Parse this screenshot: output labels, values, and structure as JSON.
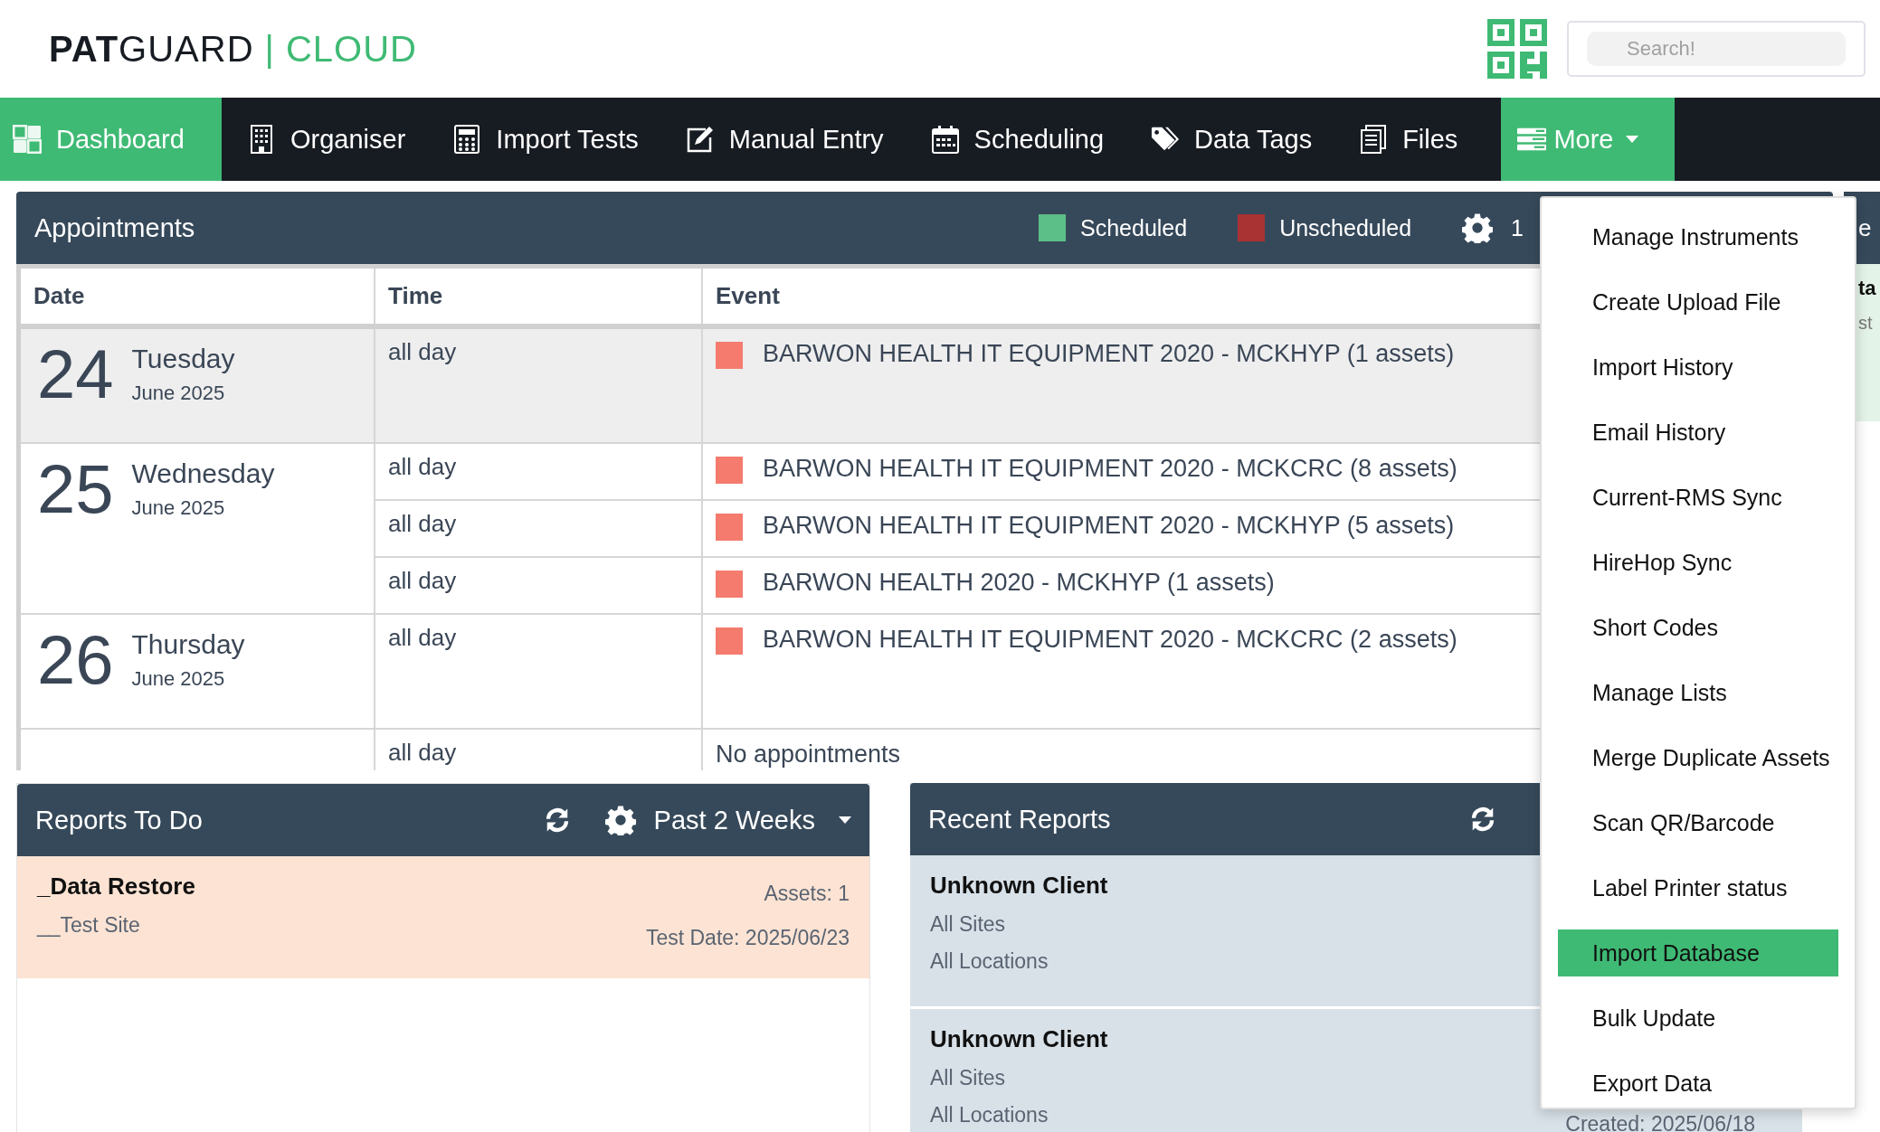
{
  "logo": {
    "bold": "PAT",
    "light": "GUARD",
    "separator": "|",
    "suffix": "CLOUD"
  },
  "search": {
    "placeholder": "Search!"
  },
  "nav": [
    {
      "label": "Dashboard",
      "kind": "dashboard",
      "selected": true
    },
    {
      "label": "Organiser",
      "kind": "building",
      "selected": false
    },
    {
      "label": "Import Tests",
      "kind": "calculator",
      "selected": false
    },
    {
      "label": "Manual Entry",
      "kind": "edit",
      "selected": false
    },
    {
      "label": "Scheduling",
      "kind": "calendar",
      "selected": false
    },
    {
      "label": "Data Tags",
      "kind": "tags",
      "selected": false
    },
    {
      "label": "Files",
      "kind": "files",
      "selected": false
    },
    {
      "label": "More",
      "kind": "list",
      "selected": true,
      "caret": true
    }
  ],
  "appointments": {
    "title": "Appointments",
    "legend": [
      {
        "label": "Scheduled",
        "color": "#5cbf87"
      },
      {
        "label": "Unscheduled",
        "color": "#a93232"
      }
    ],
    "settings_value": "1",
    "columns": [
      "Date",
      "Time",
      "Event"
    ],
    "days": [
      {
        "day": "24",
        "weekday": "Tuesday",
        "month": "June 2025",
        "shaded": true,
        "events": [
          {
            "time": "all day",
            "title": "BARWON HEALTH IT EQUIPMENT 2020 - MCKHYP (1 assets)",
            "color": "#f47b6e"
          }
        ]
      },
      {
        "day": "25",
        "weekday": "Wednesday",
        "month": "June 2025",
        "shaded": false,
        "events": [
          {
            "time": "all day",
            "title": "BARWON HEALTH IT EQUIPMENT 2020 - MCKCRC (8 assets)",
            "color": "#f47b6e"
          },
          {
            "time": "all day",
            "title": "BARWON HEALTH IT EQUIPMENT 2020 - MCKHYP (5 assets)",
            "color": "#f47b6e"
          },
          {
            "time": "all day",
            "title": "BARWON HEALTH 2020 - MCKHYP (1 assets)",
            "color": "#f47b6e"
          }
        ]
      },
      {
        "day": "26",
        "weekday": "Thursday",
        "month": "June 2025",
        "shaded": false,
        "events": [
          {
            "time": "all day",
            "title": "BARWON HEALTH IT EQUIPMENT 2020 - MCKCRC (2 assets)",
            "color": "#f47b6e"
          }
        ]
      },
      {
        "shaded": false,
        "events": [
          {
            "time": "all day",
            "title": "No appointments"
          }
        ]
      }
    ]
  },
  "side_panel": {
    "header": "e",
    "title": "ta",
    "subtitle": "st"
  },
  "reports_to_do": {
    "title": "Reports To Do",
    "filter": "Past 2 Weeks",
    "items": [
      {
        "client": "_Data Restore",
        "site": "__Test Site",
        "assets": "Assets: 1",
        "test_date": "Test Date: 2025/06/23"
      }
    ]
  },
  "recent_reports": {
    "title": "Recent Reports",
    "items": [
      {
        "client": "Unknown Client",
        "site": "All Sites",
        "location": "All Locations"
      },
      {
        "client": "Unknown Client",
        "site": "All Sites",
        "location": "All Locations",
        "created": "Created: 2025/06/18"
      }
    ]
  },
  "more_menu": {
    "items": [
      {
        "label": "Manage Instruments",
        "selected": false
      },
      {
        "label": "Create Upload File",
        "selected": false
      },
      {
        "label": "Import History",
        "selected": false
      },
      {
        "label": "Email History",
        "selected": false
      },
      {
        "label": "Current-RMS Sync",
        "selected": false
      },
      {
        "label": "HireHop Sync",
        "selected": false
      },
      {
        "label": "Short Codes",
        "selected": false
      },
      {
        "label": "Manage Lists",
        "selected": false
      },
      {
        "label": "Merge Duplicate Assets",
        "selected": false
      },
      {
        "label": "Scan QR/Barcode",
        "selected": false
      },
      {
        "label": "Label Printer status",
        "selected": false
      },
      {
        "label": "Import Database",
        "selected": true
      },
      {
        "label": "Bulk Update",
        "selected": false
      },
      {
        "label": "Export Data",
        "selected": false
      }
    ]
  }
}
